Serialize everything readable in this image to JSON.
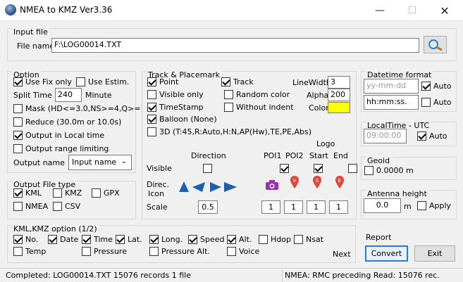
{
  "window": {
    "title": "NMEA to KMZ  Ver3.36"
  },
  "input_file": {
    "legend": "Input file",
    "file_name_label": "File name",
    "file_name_value": "F:\\LOG00014.TXT"
  },
  "option": {
    "legend": "Option",
    "use_fix_only": {
      "label": "Use Fix only",
      "checked": true
    },
    "use_estim": {
      "label": "Use Estim.",
      "checked": false
    },
    "split_time_label": "Split Time",
    "split_time_value": "240",
    "split_time_unit": "Minute",
    "mask": {
      "label": "Mask (HD<=3.0,NS>=4,Q>=1)",
      "checked": false
    },
    "reduce": {
      "label": "Reduce (30.0m or 10.0s)",
      "checked": false
    },
    "output_local_time": {
      "label": "Output in Local time",
      "checked": true
    },
    "output_range": {
      "label": "Output range limiting",
      "checked": false
    },
    "output_name_label": "Output name",
    "output_name_value": "Input name"
  },
  "output_file_type": {
    "legend": "Output File type",
    "kml": {
      "label": "KML",
      "checked": true
    },
    "kmz": {
      "label": "KMZ",
      "checked": false
    },
    "gpx": {
      "label": "GPX",
      "checked": false
    },
    "nmea": {
      "label": "NMEA",
      "checked": false
    },
    "csv": {
      "label": "CSV",
      "checked": false
    }
  },
  "track_placemark": {
    "legend": "Track & Placemark",
    "point": {
      "label": "Point",
      "checked": true
    },
    "visible_only": {
      "label": "Visible only",
      "checked": false
    },
    "timestamp": {
      "label": "TimeStamp",
      "checked": true
    },
    "balloon": {
      "label": "Balloon (None)",
      "checked": true
    },
    "track": {
      "label": "Track",
      "checked": true
    },
    "random_color": {
      "label": "Random color",
      "checked": false
    },
    "without_indent": {
      "label": "Without indent",
      "checked": false
    },
    "linewidth_label": "LineWidth",
    "linewidth_value": "3",
    "alpha_label": "Alpha",
    "alpha_value": "200",
    "color_label": "Color",
    "color_value": "#ffff00",
    "three_d": {
      "label": "3D (T:45,R:Auto,H:N,AP(Hw),TE,PE,Abs)",
      "checked": false
    },
    "headers": {
      "direction": "Direction",
      "poi1": "POI1",
      "poi2": "POI2",
      "logo": "Logo",
      "start": "Start",
      "end": "End"
    },
    "row_visible": "Visible",
    "row_direc_icon_1": "Direc.",
    "row_direc_icon_2": "Icon",
    "row_scale": "Scale",
    "visible_checks": {
      "direction": false,
      "poi1": true,
      "poi2": true,
      "start": false,
      "end": false
    },
    "scale_direction": "0.5",
    "scale_poi1": "1",
    "scale_poi2": "1",
    "scale_start": "1",
    "scale_end": "1",
    "icon_letters": {
      "poi2": "V",
      "start": "S",
      "end": "E"
    },
    "icon_colors": {
      "arrows": "#1d5fa8",
      "camera": "#9c2fb8",
      "pin": "#e2463c"
    }
  },
  "datetime_format": {
    "legend": "Datetime format",
    "date_placeholder": "yy-mm-dd",
    "date_auto": {
      "label": "Auto",
      "checked": true
    },
    "time_value": "hh:mm:ss.",
    "time_auto": {
      "label": "Auto",
      "checked": false
    }
  },
  "localtime_utc": {
    "legend": "LocalTime - UTC",
    "value": "09:00:00",
    "auto": {
      "label": "Auto",
      "checked": true
    }
  },
  "geoid": {
    "legend": "Geoid",
    "check": {
      "label": "0.0000 m",
      "checked": false
    }
  },
  "antenna_height": {
    "legend": "Antenna height",
    "value": "0.0",
    "unit": "m",
    "apply": {
      "label": "Apply",
      "checked": false
    }
  },
  "kml_option": {
    "legend": "KML,KMZ option (1/2)",
    "no": {
      "label": "No.",
      "checked": true
    },
    "date": {
      "label": "Date",
      "checked": true
    },
    "time": {
      "label": "Time",
      "checked": true
    },
    "lat": {
      "label": "Lat.",
      "checked": true
    },
    "long": {
      "label": "Long.",
      "checked": true
    },
    "speed": {
      "label": "Speed",
      "checked": true
    },
    "alt": {
      "label": "Alt.",
      "checked": true
    },
    "hdop": {
      "label": "Hdop",
      "checked": false
    },
    "nsat": {
      "label": "Nsat",
      "checked": false
    },
    "temp": {
      "label": "Temp",
      "checked": false
    },
    "pressure": {
      "label": "Pressure",
      "checked": false
    },
    "pressure_alt": {
      "label": "Pressure Alt.",
      "checked": false
    },
    "voice": {
      "label": "Voice",
      "checked": false
    },
    "next_label": "Next"
  },
  "report": {
    "label": "Report",
    "convert_label": "Convert",
    "exit_label": "Exit"
  },
  "status": {
    "left": "Completed: LOG00014.TXT  15076 records  1 file",
    "right": "NMEA: RMC preceding  Read: 15076 rec."
  }
}
